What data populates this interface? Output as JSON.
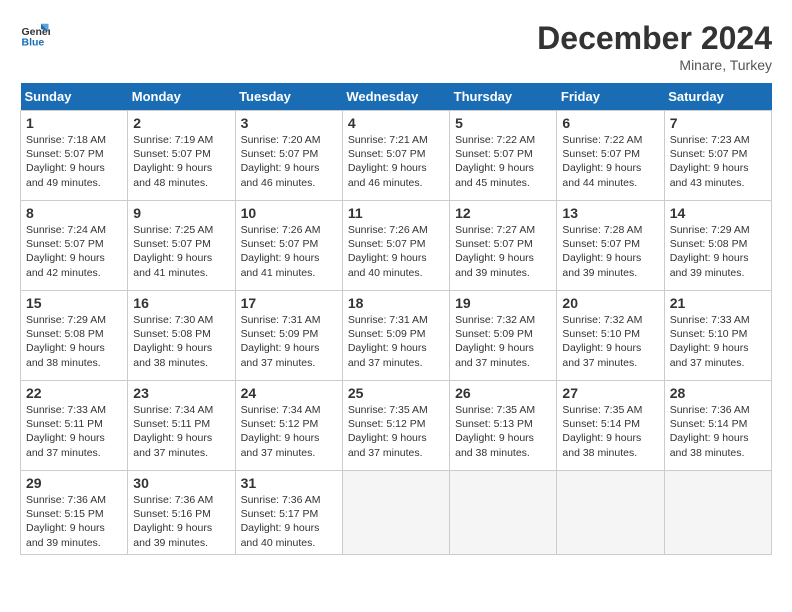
{
  "logo": {
    "line1": "General",
    "line2": "Blue"
  },
  "title": "December 2024",
  "location": "Minare, Turkey",
  "days_of_week": [
    "Sunday",
    "Monday",
    "Tuesday",
    "Wednesday",
    "Thursday",
    "Friday",
    "Saturday"
  ],
  "weeks": [
    [
      {
        "day": "1",
        "info": "Sunrise: 7:18 AM\nSunset: 5:07 PM\nDaylight: 9 hours\nand 49 minutes."
      },
      {
        "day": "2",
        "info": "Sunrise: 7:19 AM\nSunset: 5:07 PM\nDaylight: 9 hours\nand 48 minutes."
      },
      {
        "day": "3",
        "info": "Sunrise: 7:20 AM\nSunset: 5:07 PM\nDaylight: 9 hours\nand 46 minutes."
      },
      {
        "day": "4",
        "info": "Sunrise: 7:21 AM\nSunset: 5:07 PM\nDaylight: 9 hours\nand 46 minutes."
      },
      {
        "day": "5",
        "info": "Sunrise: 7:22 AM\nSunset: 5:07 PM\nDaylight: 9 hours\nand 45 minutes."
      },
      {
        "day": "6",
        "info": "Sunrise: 7:22 AM\nSunset: 5:07 PM\nDaylight: 9 hours\nand 44 minutes."
      },
      {
        "day": "7",
        "info": "Sunrise: 7:23 AM\nSunset: 5:07 PM\nDaylight: 9 hours\nand 43 minutes."
      }
    ],
    [
      {
        "day": "8",
        "info": "Sunrise: 7:24 AM\nSunset: 5:07 PM\nDaylight: 9 hours\nand 42 minutes."
      },
      {
        "day": "9",
        "info": "Sunrise: 7:25 AM\nSunset: 5:07 PM\nDaylight: 9 hours\nand 41 minutes."
      },
      {
        "day": "10",
        "info": "Sunrise: 7:26 AM\nSunset: 5:07 PM\nDaylight: 9 hours\nand 41 minutes."
      },
      {
        "day": "11",
        "info": "Sunrise: 7:26 AM\nSunset: 5:07 PM\nDaylight: 9 hours\nand 40 minutes."
      },
      {
        "day": "12",
        "info": "Sunrise: 7:27 AM\nSunset: 5:07 PM\nDaylight: 9 hours\nand 39 minutes."
      },
      {
        "day": "13",
        "info": "Sunrise: 7:28 AM\nSunset: 5:07 PM\nDaylight: 9 hours\nand 39 minutes."
      },
      {
        "day": "14",
        "info": "Sunrise: 7:29 AM\nSunset: 5:08 PM\nDaylight: 9 hours\nand 39 minutes."
      }
    ],
    [
      {
        "day": "15",
        "info": "Sunrise: 7:29 AM\nSunset: 5:08 PM\nDaylight: 9 hours\nand 38 minutes."
      },
      {
        "day": "16",
        "info": "Sunrise: 7:30 AM\nSunset: 5:08 PM\nDaylight: 9 hours\nand 38 minutes."
      },
      {
        "day": "17",
        "info": "Sunrise: 7:31 AM\nSunset: 5:09 PM\nDaylight: 9 hours\nand 37 minutes."
      },
      {
        "day": "18",
        "info": "Sunrise: 7:31 AM\nSunset: 5:09 PM\nDaylight: 9 hours\nand 37 minutes."
      },
      {
        "day": "19",
        "info": "Sunrise: 7:32 AM\nSunset: 5:09 PM\nDaylight: 9 hours\nand 37 minutes."
      },
      {
        "day": "20",
        "info": "Sunrise: 7:32 AM\nSunset: 5:10 PM\nDaylight: 9 hours\nand 37 minutes."
      },
      {
        "day": "21",
        "info": "Sunrise: 7:33 AM\nSunset: 5:10 PM\nDaylight: 9 hours\nand 37 minutes."
      }
    ],
    [
      {
        "day": "22",
        "info": "Sunrise: 7:33 AM\nSunset: 5:11 PM\nDaylight: 9 hours\nand 37 minutes."
      },
      {
        "day": "23",
        "info": "Sunrise: 7:34 AM\nSunset: 5:11 PM\nDaylight: 9 hours\nand 37 minutes."
      },
      {
        "day": "24",
        "info": "Sunrise: 7:34 AM\nSunset: 5:12 PM\nDaylight: 9 hours\nand 37 minutes."
      },
      {
        "day": "25",
        "info": "Sunrise: 7:35 AM\nSunset: 5:12 PM\nDaylight: 9 hours\nand 37 minutes."
      },
      {
        "day": "26",
        "info": "Sunrise: 7:35 AM\nSunset: 5:13 PM\nDaylight: 9 hours\nand 38 minutes."
      },
      {
        "day": "27",
        "info": "Sunrise: 7:35 AM\nSunset: 5:14 PM\nDaylight: 9 hours\nand 38 minutes."
      },
      {
        "day": "28",
        "info": "Sunrise: 7:36 AM\nSunset: 5:14 PM\nDaylight: 9 hours\nand 38 minutes."
      }
    ],
    [
      {
        "day": "29",
        "info": "Sunrise: 7:36 AM\nSunset: 5:15 PM\nDaylight: 9 hours\nand 39 minutes."
      },
      {
        "day": "30",
        "info": "Sunrise: 7:36 AM\nSunset: 5:16 PM\nDaylight: 9 hours\nand 39 minutes."
      },
      {
        "day": "31",
        "info": "Sunrise: 7:36 AM\nSunset: 5:17 PM\nDaylight: 9 hours\nand 40 minutes."
      },
      {
        "day": "",
        "info": ""
      },
      {
        "day": "",
        "info": ""
      },
      {
        "day": "",
        "info": ""
      },
      {
        "day": "",
        "info": ""
      }
    ]
  ]
}
